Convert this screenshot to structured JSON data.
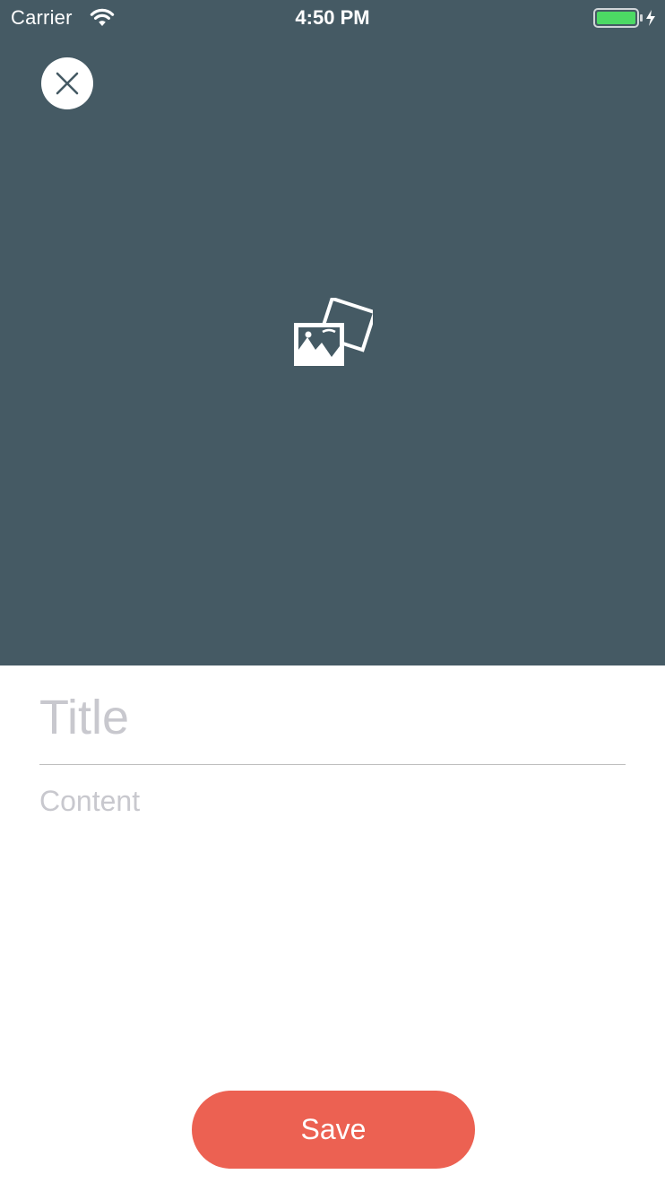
{
  "status_bar": {
    "carrier": "Carrier",
    "time": "4:50 PM",
    "wifi_icon": "wifi-icon",
    "battery_icon": "battery-charging-icon",
    "battery_color": "#4cd964"
  },
  "header": {
    "background_color": "#455a64",
    "close_icon": "close-icon",
    "image_icon": "photos-icon"
  },
  "form": {
    "title_placeholder": "Title",
    "title_value": "",
    "content_placeholder": "Content",
    "content_value": ""
  },
  "actions": {
    "save_label": "Save",
    "save_color": "#ec6152"
  }
}
